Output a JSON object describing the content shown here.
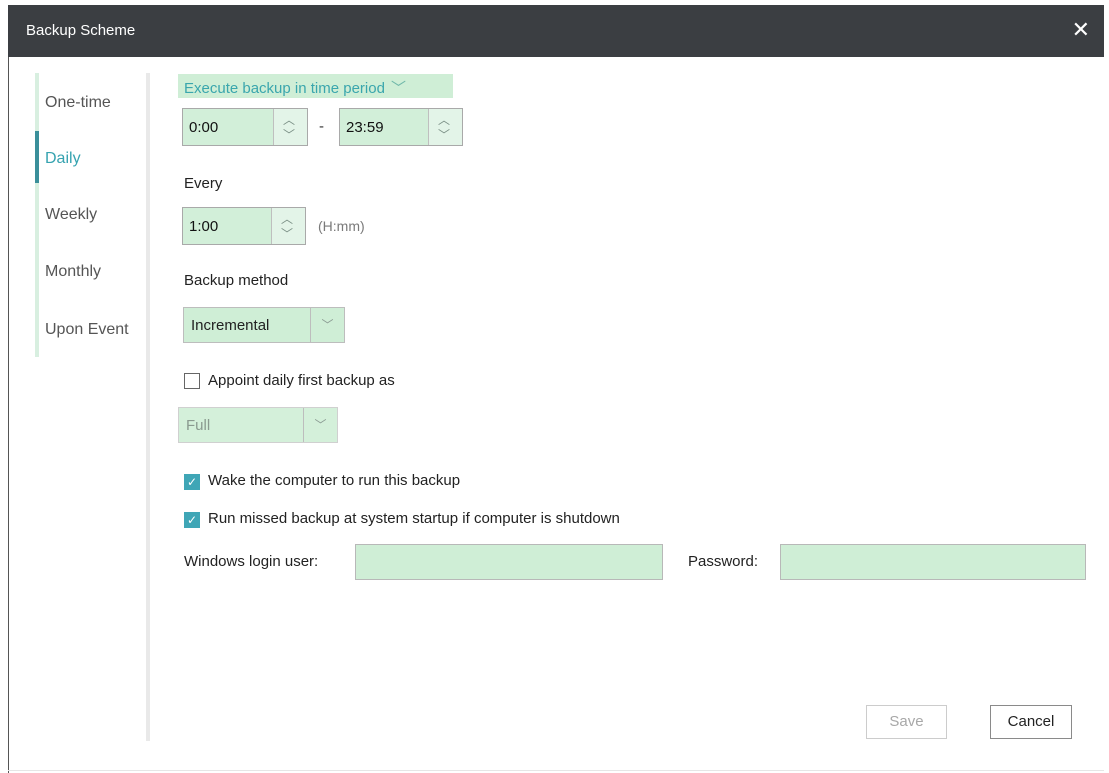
{
  "window": {
    "title": "Backup Scheme",
    "close_glyph": "✕"
  },
  "sidebar": {
    "items": [
      {
        "label": "One-time",
        "active": false
      },
      {
        "label": "Daily",
        "active": true
      },
      {
        "label": "Weekly",
        "active": false
      },
      {
        "label": "Monthly",
        "active": false
      },
      {
        "label": "Upon Event",
        "active": false
      }
    ]
  },
  "schedule": {
    "mode": {
      "label": "Execute backup in time period",
      "chevron": "﹀"
    },
    "start_time": "0:00",
    "separator": "-",
    "end_time": "23:59",
    "every_label": "Every",
    "interval": "1:00",
    "interval_hint": "(H:mm)"
  },
  "backup_method": {
    "label": "Backup method",
    "selected": "Incremental"
  },
  "first_backup": {
    "checkbox_label": "Appoint daily first backup as",
    "checked": false,
    "selected": "Full"
  },
  "options": {
    "wake": {
      "label": "Wake the computer to run this backup",
      "checked": true
    },
    "missed": {
      "label": "Run missed backup at system startup if computer is shutdown",
      "checked": true
    }
  },
  "credentials": {
    "user_label": "Windows login user:",
    "user_value": "",
    "password_label": "Password:",
    "password_value": ""
  },
  "buttons": {
    "save": "Save",
    "cancel": "Cancel"
  },
  "glyphs": {
    "up": "︿",
    "down": "﹀",
    "check": "✓"
  }
}
